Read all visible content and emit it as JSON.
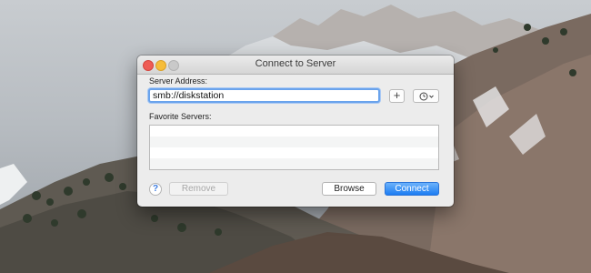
{
  "window": {
    "title": "Connect to Server"
  },
  "server_address": {
    "label": "Server Address:",
    "value": "smb://diskstation",
    "add_label": "+"
  },
  "favorites": {
    "label": "Favorite Servers:",
    "items": []
  },
  "buttons": {
    "help_label": "?",
    "remove_label": "Remove",
    "browse_label": "Browse",
    "connect_label": "Connect"
  },
  "icons": {
    "close": "close-icon",
    "minimize": "minimize-icon",
    "zoom": "zoom-icon",
    "history": "clock-icon",
    "menu": "chevron-down-icon"
  },
  "colors": {
    "accent": "#1c7df2",
    "focus_ring": "#6aa3ec",
    "close": "#ee5c54",
    "minimize": "#f6bd3a"
  }
}
